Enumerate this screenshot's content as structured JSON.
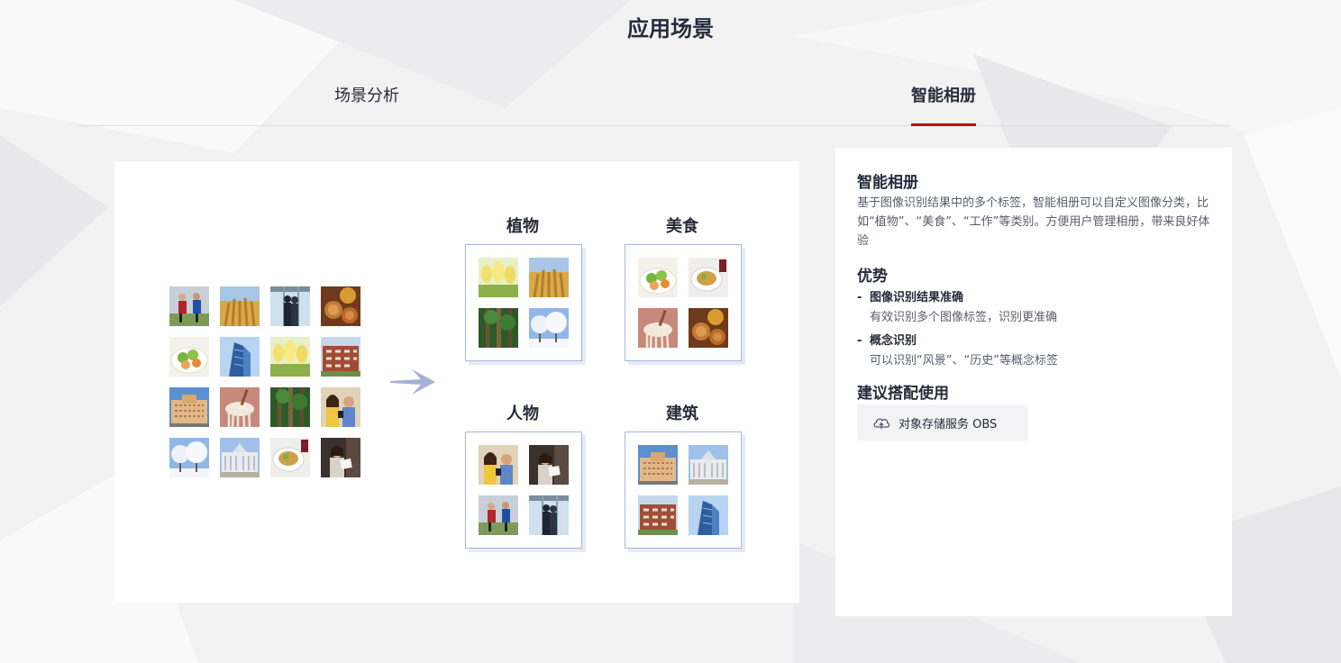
{
  "section": {
    "title": "应用场景"
  },
  "tabs": [
    {
      "label": "场景分析",
      "active": false
    },
    {
      "label": "智能相册",
      "active": true
    }
  ],
  "diagram": {
    "source_images": [
      "sports",
      "wheat",
      "people-window",
      "cookies",
      "salad",
      "skyscraper",
      "tulips",
      "brick-building",
      "hotel",
      "noodles",
      "forest",
      "friends-phone",
      "snow-tree",
      "white-palace",
      "soup-bowl",
      "woman-reading"
    ],
    "arrow_icon": "arrow-right-icon",
    "categories": [
      {
        "title": "植物",
        "images": [
          "tulips",
          "wheat",
          "forest",
          "snow-tree"
        ]
      },
      {
        "title": "美食",
        "images": [
          "salad",
          "soup-bowl",
          "noodles",
          "cookies"
        ]
      },
      {
        "title": "人物",
        "images": [
          "friends-phone",
          "woman-reading",
          "sports",
          "people-window"
        ]
      },
      {
        "title": "建筑",
        "images": [
          "hotel",
          "white-palace",
          "brick-building",
          "skyscraper"
        ]
      }
    ]
  },
  "panel": {
    "title": "智能相册",
    "description": "基于图像识别结果中的多个标签，智能相册可以自定义图像分类，比如“植物”、“美食”、“工作”等类别。方便用户管理相册，带来良好体验",
    "advantages_title": "优势",
    "advantages": [
      {
        "title": "图像识别结果准确",
        "desc": "有效识别多个图像标签，识别更准确"
      },
      {
        "title": "概念识别",
        "desc": "可以识别“风景”、“历史”等概念标签"
      }
    ],
    "recommend_title": "建议搭配使用",
    "products": [
      {
        "label": "对象存储服务 OBS",
        "icon": "cloud-upload-icon"
      }
    ]
  },
  "colors": {
    "accent": "#c7000b",
    "arrow": "#a3b1d6",
    "box_border": "#a9b6d8"
  }
}
